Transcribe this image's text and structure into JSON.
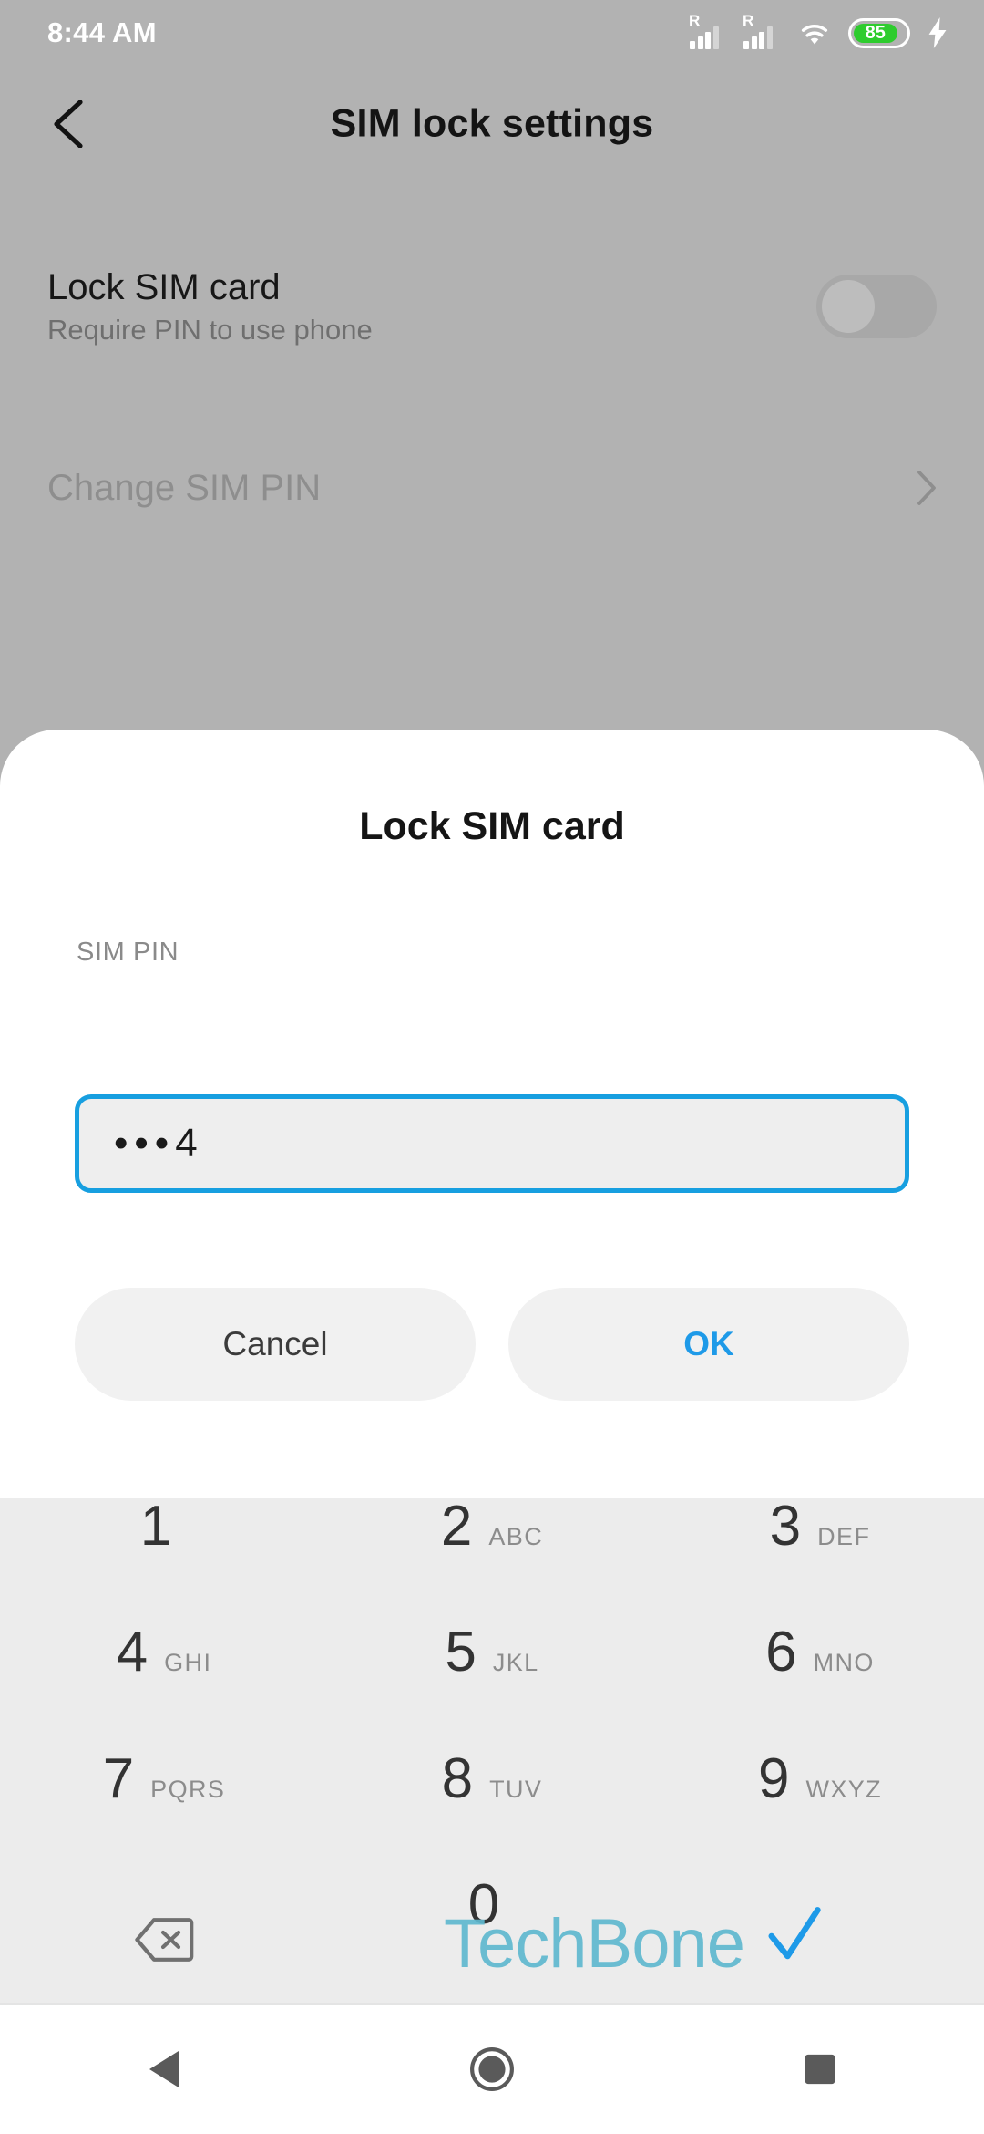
{
  "status_bar": {
    "clock": "8:44 AM",
    "battery_percent": "85",
    "battery_color": "#2ecc2e",
    "roaming_label": "R",
    "icons": [
      "signal-roaming-sim1",
      "signal-roaming-sim2",
      "wifi",
      "battery",
      "charging-bolt"
    ]
  },
  "app_bar": {
    "title": "SIM lock settings",
    "back_icon": "chevron-left-icon"
  },
  "settings": {
    "lock_sim": {
      "title": "Lock SIM card",
      "subtitle": "Require PIN to use phone",
      "toggle_state": "off"
    },
    "change_pin": {
      "title": "Change SIM PIN",
      "chevron": "chevron-right-icon",
      "enabled": "false"
    }
  },
  "dialog": {
    "title": "Lock SIM card",
    "field_label": "SIM PIN",
    "pin_value": "•••4",
    "pin_placeholder": "",
    "accent_color": "#179fe0",
    "cancel_label": "Cancel",
    "ok_label": "OK"
  },
  "keypad": {
    "keys": [
      {
        "digit": "1",
        "letters": ""
      },
      {
        "digit": "2",
        "letters": "ABC"
      },
      {
        "digit": "3",
        "letters": "DEF"
      },
      {
        "digit": "4",
        "letters": "GHI"
      },
      {
        "digit": "5",
        "letters": "JKL"
      },
      {
        "digit": "6",
        "letters": "MNO"
      },
      {
        "digit": "7",
        "letters": "PQRS"
      },
      {
        "digit": "8",
        "letters": "TUV"
      },
      {
        "digit": "9",
        "letters": "WXYZ"
      },
      {
        "digit": "0",
        "letters": ""
      }
    ],
    "backspace_icon": "backspace-icon"
  },
  "watermark": {
    "text": "TechBone",
    "color": "#5fb8cf"
  },
  "nav_bar": {
    "back": "triangle-back-icon",
    "home": "circle-home-icon",
    "recents": "square-recents-icon"
  }
}
